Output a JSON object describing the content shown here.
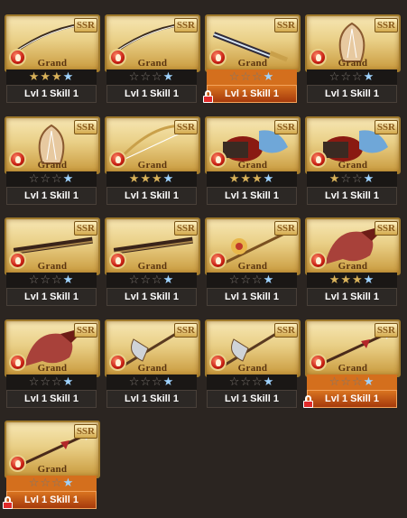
{
  "cards": [
    {
      "name": "Grand",
      "rarity": "SSR",
      "level": "Lvl 1 Skill 1",
      "stars": [
        "f",
        "f",
        "f",
        "b"
      ],
      "locked": false,
      "weapon": "katana"
    },
    {
      "name": "Grand",
      "rarity": "SSR",
      "level": "Lvl 1 Skill 1",
      "stars": [
        "e",
        "e",
        "e",
        "b"
      ],
      "locked": false,
      "weapon": "katana"
    },
    {
      "name": "Grand",
      "rarity": "SSR",
      "level": "Lvl 1 Skill 1",
      "stars": [
        "e",
        "e",
        "e",
        "b"
      ],
      "locked": true,
      "weapon": "greatsword"
    },
    {
      "name": "Grand",
      "rarity": "SSR",
      "level": "Lvl 1 Skill 1",
      "stars": [
        "e",
        "e",
        "e",
        "b"
      ],
      "locked": false,
      "weapon": "harp"
    },
    {
      "name": "Grand",
      "rarity": "SSR",
      "level": "Lvl 1 Skill 1",
      "stars": [
        "e",
        "e",
        "e",
        "b"
      ],
      "locked": false,
      "weapon": "harp"
    },
    {
      "name": "Grand",
      "rarity": "SSR",
      "level": "Lvl 1 Skill 1",
      "stars": [
        "f",
        "f",
        "f",
        "b"
      ],
      "locked": false,
      "weapon": "bow"
    },
    {
      "name": "Grand",
      "rarity": "SSR",
      "level": "Lvl 1 Skill 1",
      "stars": [
        "f",
        "f",
        "f",
        "b"
      ],
      "locked": false,
      "weapon": "gauntlet"
    },
    {
      "name": "Grand",
      "rarity": "SSR",
      "level": "Lvl 1 Skill 1",
      "stars": [
        "f",
        "e",
        "e",
        "b"
      ],
      "locked": false,
      "weapon": "gauntlet"
    },
    {
      "name": "Grand",
      "rarity": "SSR",
      "level": "Lvl 1 Skill 1",
      "stars": [
        "e",
        "e",
        "e",
        "b"
      ],
      "locked": false,
      "weapon": "gun"
    },
    {
      "name": "Grand",
      "rarity": "SSR",
      "level": "Lvl 1 Skill 1",
      "stars": [
        "e",
        "e",
        "e",
        "b"
      ],
      "locked": false,
      "weapon": "gun"
    },
    {
      "name": "Grand",
      "rarity": "SSR",
      "level": "Lvl 1 Skill 1",
      "stars": [
        "e",
        "e",
        "e",
        "b"
      ],
      "locked": false,
      "weapon": "staff"
    },
    {
      "name": "Grand",
      "rarity": "SSR",
      "level": "Lvl 1 Skill 1",
      "stars": [
        "f",
        "f",
        "f",
        "b"
      ],
      "locked": false,
      "weapon": "dragon"
    },
    {
      "name": "Grand",
      "rarity": "SSR",
      "level": "Lvl 1 Skill 1",
      "stars": [
        "e",
        "e",
        "e",
        "b"
      ],
      "locked": false,
      "weapon": "dragon"
    },
    {
      "name": "Grand",
      "rarity": "SSR",
      "level": "Lvl 1 Skill 1",
      "stars": [
        "e",
        "e",
        "e",
        "b"
      ],
      "locked": false,
      "weapon": "axe"
    },
    {
      "name": "Grand",
      "rarity": "SSR",
      "level": "Lvl 1 Skill 1",
      "stars": [
        "e",
        "e",
        "e",
        "b"
      ],
      "locked": false,
      "weapon": "axe"
    },
    {
      "name": "Grand",
      "rarity": "SSR",
      "level": "Lvl 1 Skill 1",
      "stars": [
        "e",
        "e",
        "e",
        "b"
      ],
      "locked": true,
      "weapon": "spear"
    },
    {
      "name": "Grand",
      "rarity": "SSR",
      "level": "Lvl 1 Skill 1",
      "stars": [
        "e",
        "e",
        "e",
        "b"
      ],
      "locked": true,
      "weapon": "spear"
    }
  ],
  "icons": {
    "element": "fire-element-icon",
    "lock": "lock-icon",
    "star": "star-icon"
  },
  "colors": {
    "background": "#2b2521",
    "locked_bar": "#c85a14",
    "frame": "#a07a2c",
    "fire": "#c81e12"
  }
}
